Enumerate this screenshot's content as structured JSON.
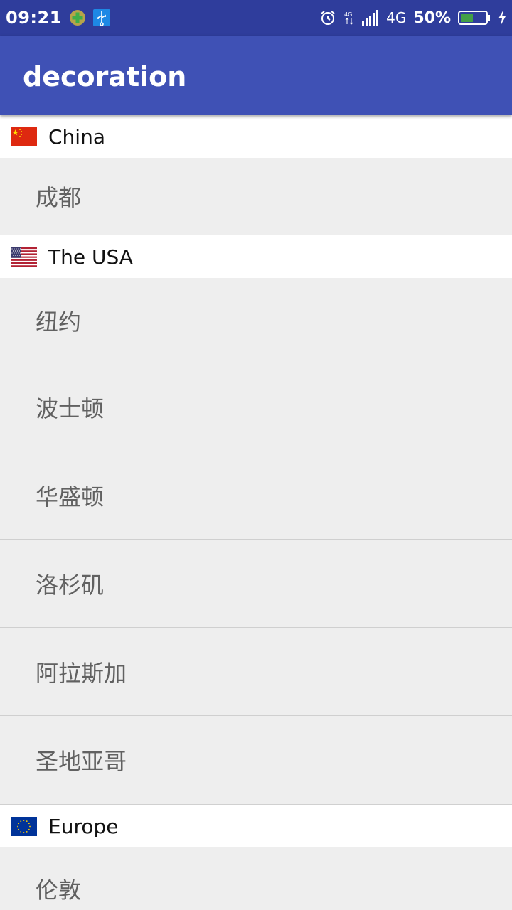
{
  "status_bar": {
    "time": "09:21",
    "network": "4G",
    "battery_percent": "50%",
    "battery_level": 0.5,
    "icons": [
      "plus-circle-icon",
      "usb-icon",
      "alarm-icon",
      "4g-signal-icon",
      "signal-bars-icon",
      "battery-icon",
      "charging-icon"
    ]
  },
  "app_bar": {
    "title": "decoration",
    "color": "#3f51b5"
  },
  "groups": [
    {
      "name": "China",
      "flag_icon": "china-flag-icon",
      "items": [
        "成都"
      ]
    },
    {
      "name": "The USA",
      "flag_icon": "usa-flag-icon",
      "items": [
        "纽约",
        "波士顿",
        "华盛顿",
        "洛杉矶",
        "阿拉斯加",
        "圣地亚哥"
      ]
    },
    {
      "name": "Europe",
      "flag_icon": "eu-flag-icon",
      "items": [
        "伦敦"
      ]
    }
  ]
}
